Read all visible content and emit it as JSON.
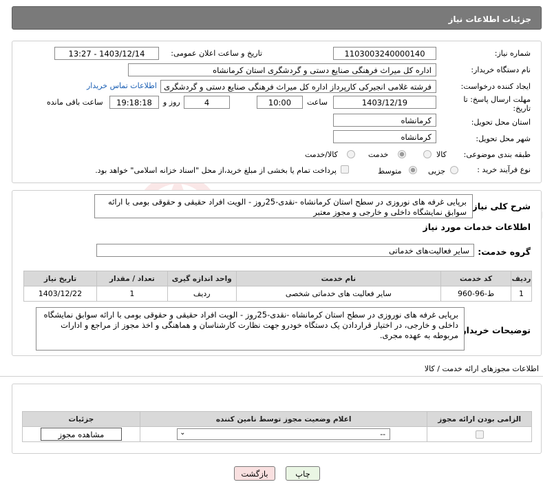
{
  "header": {
    "title": "جزئیات اطلاعات نیاز"
  },
  "form": {
    "need_number_label": "شماره نیاز:",
    "need_number": "1103003240000140",
    "announce_datetime_label": "تاریخ و ساعت اعلان عمومی:",
    "announce_datetime": "1403/12/14 - 13:27",
    "buyer_org_label": "نام دستگاه خریدار:",
    "buyer_org": "اداره کل میراث فرهنگی  صنایع دستی و گردشگری استان کرمانشاه",
    "creator_label": "ایجاد کننده درخواست:",
    "creator": "فرشته غلامی انجیرکی کارپرداز اداره کل میراث فرهنگی  صنایع دستی و گردشگری استان کرمانشاه",
    "buyer_contact_link": "اطلاعات تماس خریدار",
    "deadline_label": "مهلت ارسال پاسخ: تا تاریخ:",
    "deadline_date": "1403/12/19",
    "time_label": "ساعت",
    "deadline_time": "10:00",
    "days_value": "4",
    "days_label": "روز و",
    "remaining_time": "19:18:18",
    "remaining_label": "ساعت باقی مانده",
    "province_label": "استان محل تحویل:",
    "province": "کرمانشاه",
    "city_label": "شهر محل تحویل:",
    "city": "کرمانشاه",
    "category_label": "طبقه بندی موضوعی:",
    "category_options": [
      "کالا",
      "خدمت",
      "کالا/خدمت"
    ],
    "category_selected": "خدمت",
    "process_label": "نوع فرآیند خرید :",
    "process_options": [
      "جزیی",
      "متوسط"
    ],
    "process_selected": "جزیی",
    "payment_note": "پرداخت تمام یا بخشی از مبلغ خرید،از محل \"اسناد خزانه اسلامی\" خواهد بود."
  },
  "summary": {
    "label": "شرح کلی نیاز:",
    "text": "برپایی غرفه های نوروزی در سطح استان کرمانشاه -نقدی-25روز - الویت افراد حقیقی و حقوقی بومی با ارائه سوابق نمایشگاه داخلی و خارجی و مجوز معتبر"
  },
  "services": {
    "section_title": "اطلاعات خدمات مورد نیاز",
    "group_label": "گروه خدمت:",
    "group_value": "سایر فعالیت‌های خدماتی",
    "columns": [
      "ردیف",
      "کد خدمت",
      "نام خدمت",
      "واحد اندازه گیری",
      "تعداد / مقدار",
      "تاریخ نیاز"
    ],
    "rows": [
      {
        "row": "1",
        "code": "ط-96-960",
        "name": "سایر فعالیت های خدماتی شخصی",
        "unit": "ردیف",
        "qty": "1",
        "date": "1403/12/22"
      }
    ]
  },
  "buyer_notes": {
    "label": "توضیحات خریدار:",
    "text": "برپایی غرفه های نوروزی در سطح استان کرمانشاه -نقدی-25روز - الویت افراد حقیقی و حقوقی بومی با ارائه سوابق نمایشگاه داخلی و خارجی، در اختیار قراردادن یک دستگاه خودرو جهت نظارت کارشناسان و هماهنگی و اخذ مجوز از مراجع و ادارات مربوطه به عهده مجری."
  },
  "permits": {
    "section_title": "اطلاعات مجوزهای ارائه خدمت / کالا",
    "columns": [
      "الزامی بودن ارائه مجوز",
      "اعلام وضعیت مجوز توسط نامین کننده",
      "جزئیات"
    ],
    "select_value": "--",
    "view_button": "مشاهده مجوز"
  },
  "actions": {
    "print": "چاپ",
    "back": "بازگشت"
  },
  "watermark": {
    "text": "AriaTender.neT"
  }
}
